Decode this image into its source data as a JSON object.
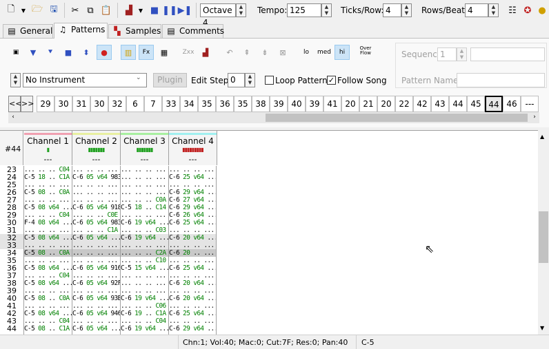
{
  "toolbar": {
    "octave": "Octave 4",
    "tempo_label": "Tempo:",
    "tempo": "125",
    "ticks_label": "Ticks/Row:",
    "ticks": "4",
    "rows_label": "Rows/Beat:",
    "rows": "4"
  },
  "tabs": [
    {
      "label": "General"
    },
    {
      "label": "Patterns"
    },
    {
      "label": "Samples"
    },
    {
      "label": "Comments"
    }
  ],
  "controls": {
    "lo": "lo",
    "med": "med",
    "hi": "hi",
    "overflow": "Over Flow",
    "sequence_label": "Sequence",
    "sequence": "1",
    "instrument": "No Instrument",
    "plugin": "Plugin",
    "edit_step_label": "Edit Step",
    "edit_step": "0",
    "loop_pattern": "Loop Pattern",
    "follow_song": "Follow Song",
    "pattern_name_label": "Pattern Name",
    "nav_prev": "<<",
    "nav_next": ">>"
  },
  "orders": [
    "29",
    "30",
    "31",
    "30",
    "32",
    "6",
    "7",
    "33",
    "34",
    "35",
    "36",
    "35",
    "38",
    "39",
    "40",
    "39",
    "41",
    "20",
    "21",
    "20",
    "22",
    "42",
    "43",
    "44",
    "45",
    "44",
    "46",
    "---"
  ],
  "pattern": {
    "number": "#44",
    "channels": [
      {
        "name": "Channel 1",
        "color": "#f0a0b0",
        "vu": "▮",
        "empty": "---"
      },
      {
        "name": "Channel 2",
        "color": "#e8f0a0",
        "vu": "▮▮▮▮▮▮▮",
        "empty": "---"
      },
      {
        "name": "Channel 3",
        "color": "#a8f0a0",
        "vu": "▮▮▮▮▮▮▮",
        "empty": "---"
      },
      {
        "name": "Channel 4",
        "color": "#a0f0f0",
        "vu": "▮▮▮▮▮▮▮▮▮",
        "empty": "---"
      }
    ],
    "rows": [
      {
        "n": "23",
        "c": [
          "... .. .. C04",
          "... .. .. ...",
          "... .. .. ...",
          "... .. .. ..."
        ]
      },
      {
        "n": "24",
        "c": [
          "C-5 18 .. C1A",
          "C-6 05 v64 983",
          "... .. .. ...",
          "C-6 25 v64 ..."
        ]
      },
      {
        "n": "25",
        "c": [
          "... .. .. ...",
          "... .. .. ...",
          "... .. .. ...",
          "... .. .. ..."
        ]
      },
      {
        "n": "26",
        "c": [
          "C-5 08 .. C0A",
          "... .. .. ...",
          "... .. .. ...",
          "C-6 29 v64 ..."
        ]
      },
      {
        "n": "27",
        "c": [
          "... .. .. ...",
          "... .. .. ...",
          "... .. .. C0A",
          "C-6 27 v64 ..."
        ]
      },
      {
        "n": "28",
        "c": [
          "C-5 08 v64 ...",
          "C-6 05 v64 918",
          "C-5 18 .. C14",
          "C-6 29 v64 ..."
        ]
      },
      {
        "n": "29",
        "c": [
          "... .. .. C04",
          "... .. .. C0E",
          "... .. .. ...",
          "C-6 26 v64 ..."
        ]
      },
      {
        "n": "30",
        "c": [
          "F-4 08 v64 ...",
          "C-6 05 v64 983",
          "C-6 19 v64 ...",
          "C-6 25 v64 ..."
        ]
      },
      {
        "n": "31",
        "c": [
          "... .. .. ...",
          "... .. .. C1A",
          "... .. .. C03",
          "... .. .. ..."
        ]
      },
      {
        "n": "32",
        "c": [
          "C-5 08 v64 ...",
          "C-6 05 v64 ...",
          "C-6 19 v64 ...",
          "C-6 20 v64 ..."
        ]
      },
      {
        "n": "33",
        "c": [
          "... .. .. ...",
          "... .. .. ...",
          "... .. .. ...",
          "... .. .. ..."
        ]
      },
      {
        "n": "34",
        "c": [
          "C-5 08 .. C0A",
          "... .. .. ...",
          "... .. .. C2A",
          "C-6 20 .. ..."
        ]
      },
      {
        "n": "35",
        "c": [
          "... .. .. ...",
          "... .. .. ...",
          "... .. .. C10",
          "... .. .. ..."
        ]
      },
      {
        "n": "36",
        "c": [
          "C-5 08 v64 ...",
          "C-6 05 v64 916",
          "C-5 15 v64 ...",
          "C-6 25 v64 ..."
        ]
      },
      {
        "n": "37",
        "c": [
          "... .. .. C04",
          "... .. .. ...",
          "... .. .. ...",
          "... .. .. ..."
        ]
      },
      {
        "n": "38",
        "c": [
          "C-5 08 v64 ...",
          "C-6 05 v64 92F",
          "... .. .. ...",
          "C-6 20 v64 ..."
        ]
      },
      {
        "n": "39",
        "c": [
          "... .. .. ...",
          "... .. .. ...",
          "... .. .. ...",
          "... .. .. ..."
        ]
      },
      {
        "n": "40",
        "c": [
          "C-5 08 .. C0A",
          "C-6 05 v64 93B",
          "C-6 19 v64 ...",
          "C-6 20 v64 ..."
        ]
      },
      {
        "n": "41",
        "c": [
          "... .. .. ...",
          "... .. .. ...",
          "... .. .. C06",
          "... .. .. ..."
        ]
      },
      {
        "n": "42",
        "c": [
          "C-5 08 v64 ...",
          "C-6 05 v64 946",
          "C-6 19 .. C1A",
          "C-6 25 v64 ..."
        ]
      },
      {
        "n": "43",
        "c": [
          "... .. .. C04",
          "... .. .. ...",
          "... .. .. C04",
          "... .. .. ..."
        ]
      },
      {
        "n": "44",
        "c": [
          "C-5 08 .. C1A",
          "C-6 05 v64 ...",
          "C-6 19 v64 ...",
          "C-6 29 v64 ..."
        ]
      }
    ]
  },
  "status": {
    "info": "Chn:1; Vol:40; Mac:0; Cut:7F; Res:0; Pan:40",
    "note": "C-5"
  }
}
